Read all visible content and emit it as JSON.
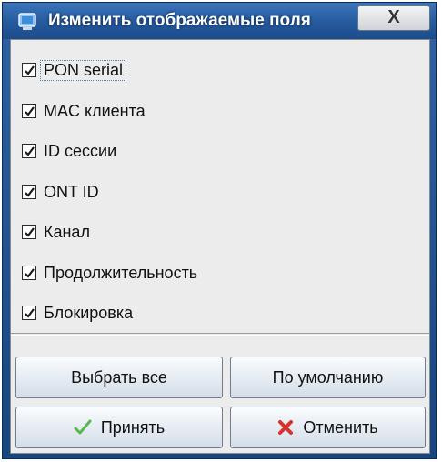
{
  "window": {
    "title": "Изменить отображаемые поля",
    "close_label": "X"
  },
  "fields": [
    {
      "label": "PON serial",
      "checked": true
    },
    {
      "label": "MAC клиента",
      "checked": true
    },
    {
      "label": "ID сессии",
      "checked": true
    },
    {
      "label": "ONT ID",
      "checked": true
    },
    {
      "label": "Канал",
      "checked": true
    },
    {
      "label": "Продолжительность",
      "checked": true
    },
    {
      "label": "Блокировка",
      "checked": true
    }
  ],
  "buttons": {
    "select_all": "Выбрать все",
    "default": "По умолчанию",
    "accept": "Принять",
    "cancel": "Отменить"
  },
  "icons": {
    "app": "window-icon",
    "accept": "check-icon",
    "cancel": "red-x-icon"
  },
  "colors": {
    "titlebar": "#255a9d",
    "accept_icon": "#58b84a",
    "cancel_icon": "#d8322d"
  }
}
